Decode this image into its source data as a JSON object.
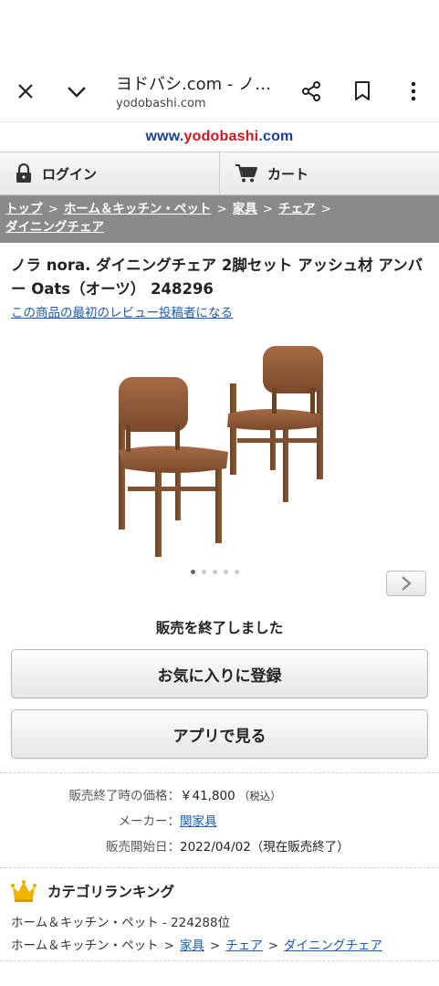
{
  "browser": {
    "title": "ヨドバシ.com - ノ…",
    "domain": "yodobashi.com"
  },
  "logo": {
    "prefix": "www.",
    "brand": "yodobashi",
    "suffix": ".com"
  },
  "nav": {
    "login": "ログイン",
    "cart": "カート"
  },
  "breadcrumb": {
    "items": [
      "トップ",
      "ホーム＆キッチン・ペット",
      "家具",
      "チェア",
      "ダイニングチェア"
    ],
    "sep": ">"
  },
  "product": {
    "title": "ノラ nora. ダイニングチェア 2脚セット アッシュ材 アンバー Oats（オーツ） 248296",
    "review_link": "この商品の最初のレビュー投稿者になる",
    "image_count": 5,
    "active_image": 0
  },
  "status": {
    "sold_out": "販売を終了しました"
  },
  "buttons": {
    "favorite": "お気に入りに登録",
    "app": "アプリで見る"
  },
  "details": {
    "price_label": "販売終了時の価格：",
    "price_value": "￥41,800",
    "price_note": "（税込）",
    "maker_label": "メーカー：",
    "maker_value": "関家具",
    "release_label": "販売開始日：",
    "release_value": "2022/04/02（現在販売終了）"
  },
  "ranking": {
    "heading": "カテゴリランキング",
    "line1": "ホーム＆キッチン・ペット - 224288位",
    "line2_prefix": "ホーム＆キッチン・ペット",
    "line2_links": [
      "家具",
      "チェア",
      "ダイニングチェア"
    ],
    "sep": ">"
  },
  "colors": {
    "brand_blue": "#1a3f95",
    "brand_red": "#d4141e",
    "link": "#1a5ab4",
    "breadcrumb_bg": "#8a8a8a",
    "crown": "#f0b400"
  }
}
